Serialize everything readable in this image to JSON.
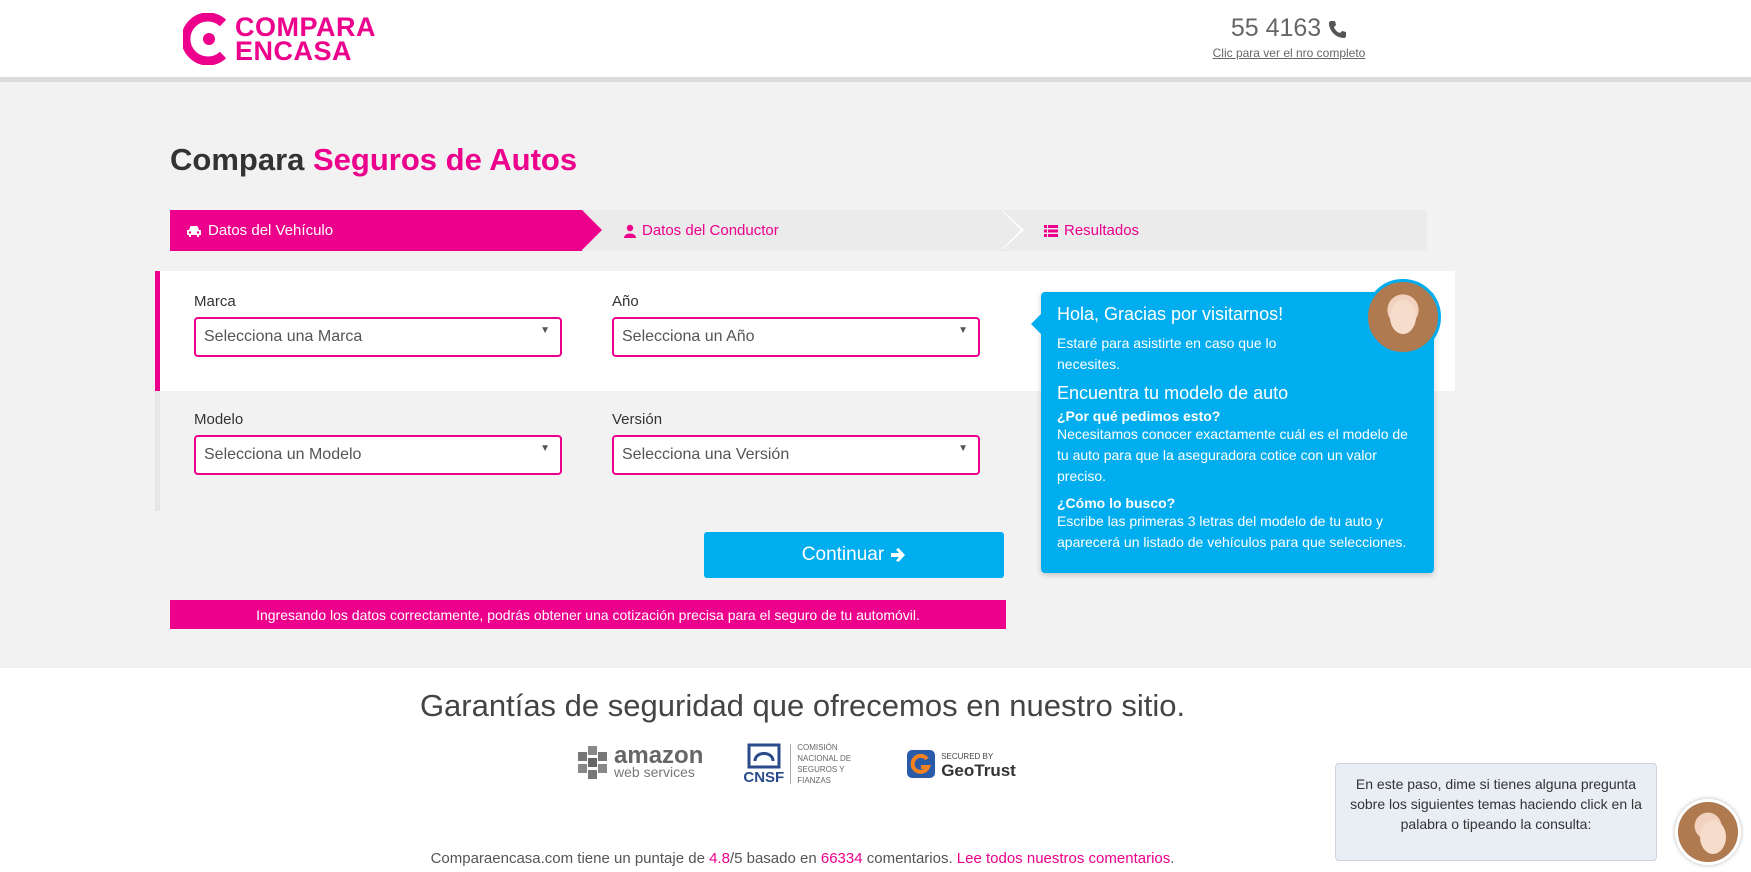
{
  "header": {
    "logo_line1": "COMPARA",
    "logo_line2": "ENCASA",
    "phone": "55 4163",
    "phone_link": "Clic para ver el nro completo"
  },
  "page": {
    "title_prefix": "Compara",
    "title_highlight": "Seguros de Autos"
  },
  "steps": [
    {
      "label": "Datos del Vehículo",
      "icon": "car-icon",
      "active": true
    },
    {
      "label": "Datos del Conductor",
      "icon": "user-icon",
      "active": false
    },
    {
      "label": "Resultados",
      "icon": "list-icon",
      "active": false
    }
  ],
  "form": {
    "marca_label": "Marca",
    "marca_value": "Selecciona una Marca",
    "anio_label": "Año",
    "anio_value": "Selecciona un Año",
    "modelo_label": "Modelo",
    "modelo_value": "Selecciona un Modelo",
    "version_label": "Versión",
    "version_value": "Selecciona una Versión",
    "continue_label": "Continuar",
    "info_text": "Ingresando los datos correctamente, podrás obtener una cotización precisa para el seguro de tu automóvil."
  },
  "tooltip": {
    "greeting": "Hola, Gracias por visitarnos!",
    "intro": "Estaré para asistirte en caso que lo necesites.",
    "heading": "Encuentra tu modelo de auto",
    "q1": "¿Por qué pedimos esto?",
    "a1": "Necesitamos conocer exactamente cuál es el modelo de tu auto para que la aseguradora cotice con un valor preciso.",
    "q2": "¿Cómo lo busco?",
    "a2": "Escribe las primeras 3 letras del modelo de tu auto y aparecerá un listado de vehículos para que selecciones."
  },
  "footer": {
    "guarantee": "Garantías de seguridad que ofrecemos en nuestro sitio.",
    "badge_amazon_1": "amazon",
    "badge_amazon_2": "web services",
    "badge_cnsf": "CNSF",
    "badge_cnsf_sub": "COMISIÓN NACIONAL DE SEGUROS Y FIANZAS",
    "badge_geo_small": "SECURED BY",
    "badge_geo": "GeoTrust",
    "rating_prefix": "Comparaencasa.com tiene un puntaje de",
    "rating_score": "4.8",
    "rating_mid": "/5 basado en",
    "rating_count": "66334",
    "rating_suffix": "comentarios.",
    "rating_link": "Lee todos nuestros comentarios"
  },
  "chat": {
    "message": "En este paso, dime si tienes alguna pregunta sobre los siguientes temas haciendo click en la palabra o tipeando la consulta:"
  },
  "colors": {
    "brand_pink": "#ec008c",
    "accent_blue": "#00aeef"
  }
}
